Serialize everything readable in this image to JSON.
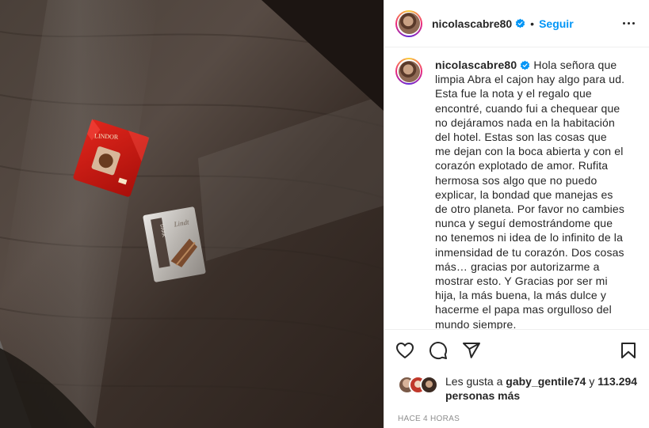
{
  "post": {
    "username": "nicolascabre80",
    "separator": "•",
    "follow_label": "Seguir",
    "caption_username": "nicolascabre80",
    "caption": "Hola señora que limpia Abra el cajon hay algo para ud. Esta fue la nota y el regalo que encontré, cuando fui a chequear que no dejáramos nada en la habitación del hotel. Estas son las cosas que me dejan con la boca abierta y con el corazón explotado de amor. Rufita hermosa sos algo que no puedo explicar, la bondad que manejas es de otro planeta. Por favor no cambies nunca y seguí demostrándome que no tenemos ni idea de lo infinito de la inmensidad de tu corazón. Dos cosas más… gracias por autorizarme a mostrar esto. Y Gracias por ser mi hija, la más buena, la más dulce y hacerme el papa mas orgulloso del mundo siempre.",
    "likes": {
      "prefix": "Les gusta a",
      "user": "gaby_gentile74",
      "connector": "y",
      "count": "113.294 personas más"
    },
    "timestamp": "HACE 4 HORAS",
    "image": {
      "wrapper_red_brand": "LINDOR",
      "wrapper_silver_brand": "Lindt",
      "wrapper_silver_label": "DARK"
    }
  },
  "icons": {
    "verified": "verified-badge-icon",
    "more": "more-options-icon",
    "like": "heart-icon",
    "comment": "comment-icon",
    "share": "share-icon",
    "save": "bookmark-icon"
  },
  "colors": {
    "accent": "#0095f6",
    "text": "#262626",
    "muted": "#8e8e8e",
    "divider": "#efefef"
  }
}
